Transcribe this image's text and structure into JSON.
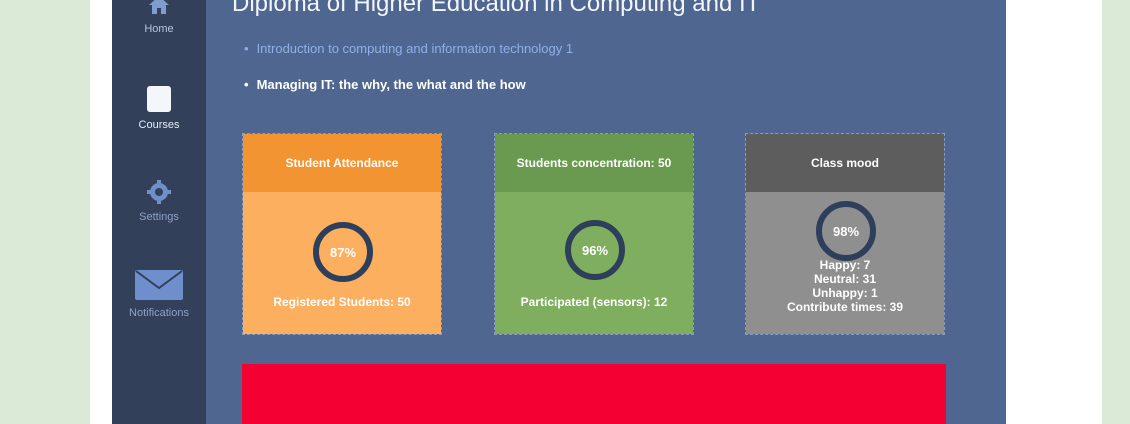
{
  "colors": {
    "page_bg": "#dbe9d7",
    "app_bg": "#4f6690",
    "sidebar_bg": "#324059",
    "attendance_orange": "#f39433",
    "concentration_green": "#6a9a4f",
    "mood_gray": "#8f8f8f",
    "banner_red": "#f50032"
  },
  "sidebar": {
    "items": [
      {
        "label": "Home",
        "icon": "home-icon"
      },
      {
        "label": "Courses",
        "icon": "courses-icon"
      },
      {
        "label": "Settings",
        "icon": "gear-icon"
      },
      {
        "label": "Notifications",
        "icon": "mail-icon"
      }
    ]
  },
  "main": {
    "title": "Diploma of Higher Education in Computing and IT",
    "modules": [
      {
        "label": "Introduction to computing and information technology 1"
      },
      {
        "label": "Managing IT: the why, the what and the how"
      }
    ]
  },
  "cards": {
    "attendance": {
      "title": "Student Attendance",
      "percent": "87%",
      "footer": "Registered Students: 50"
    },
    "concentration": {
      "title": "Students concentration: 50",
      "percent": "96%",
      "footer": "Participated (sensors): 12"
    },
    "mood": {
      "title": "Class mood",
      "percent": "98%",
      "lines": [
        "Happy: 7",
        "Neutral: 31",
        "Unhappy: 1",
        "Contribute times: 39"
      ]
    }
  }
}
